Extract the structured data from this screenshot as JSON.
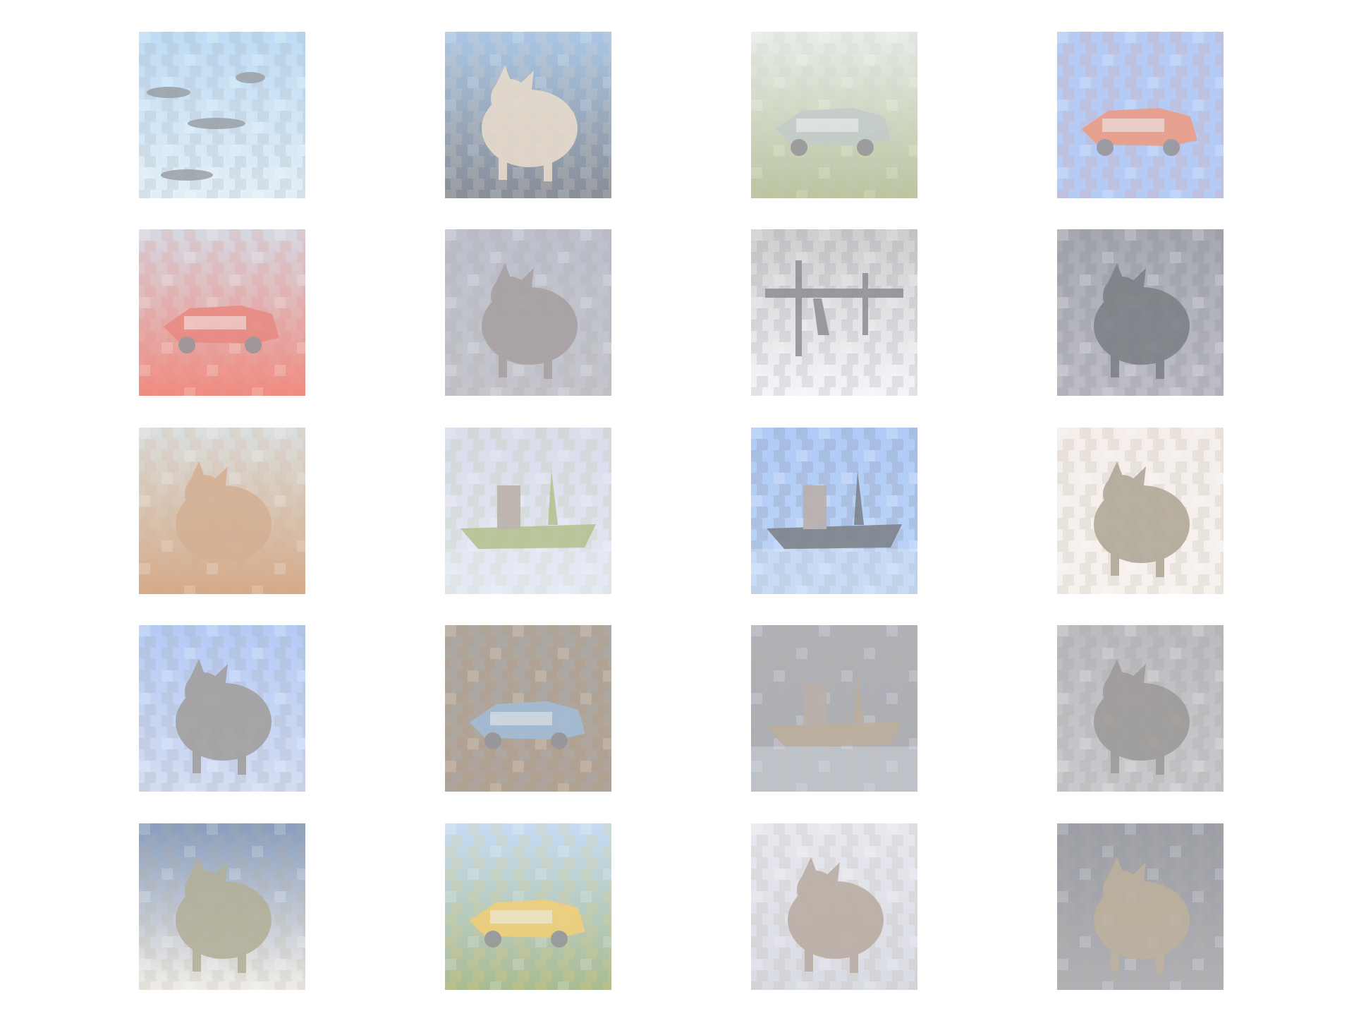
{
  "grid": {
    "rows": 5,
    "columns": 4,
    "background": "#ffffff",
    "tiles": [
      {
        "subject": "aircraft-formation-sky",
        "sky": "#8fc3ee",
        "ground": "#cfe3f1",
        "subject_color": "#56606a"
      },
      {
        "subject": "bird-over-dark-ground",
        "sky": "#6e9fd3",
        "ground": "#353d4d",
        "subject_color": "#d8c2a8"
      },
      {
        "subject": "truck-in-yard",
        "sky": "#d9e0da",
        "ground": "#8a9a57",
        "subject_color": "#9aa8a6"
      },
      {
        "subject": "orange-vehicle-blue-sky",
        "sky": "#7fa7ef",
        "ground": "#7fa7ef",
        "subject_color": "#e2542a"
      },
      {
        "subject": "red-vehicle-haze",
        "sky": "#b8bfd0",
        "ground": "#e63b27",
        "subject_color": "#d8372a"
      },
      {
        "subject": "animal-closeup",
        "sky": "#8f93a8",
        "ground": "#9b9ea9",
        "subject_color": "#6a5d61"
      },
      {
        "subject": "structure-pale-sky",
        "sky": "#aaaaae",
        "ground": "#eeeff4",
        "subject_color": "#42414b"
      },
      {
        "subject": "cat-closeup",
        "sky": "#676a77",
        "ground": "#8f8f9e",
        "subject_color": "#20262f"
      },
      {
        "subject": "deer-in-field",
        "sky": "#c1c9c8",
        "ground": "#b86d32",
        "subject_color": "#b67848"
      },
      {
        "subject": "airship-pale-sky",
        "sky": "#bec5df",
        "ground": "#d3d8ea",
        "subject_color": "#7f963f"
      },
      {
        "subject": "ship-on-water",
        "sky": "#77a6f2",
        "ground": "#8eb6f0",
        "subject_color": "#222832"
      },
      {
        "subject": "animal-on-white",
        "sky": "#eee3dc",
        "ground": "#f1e9e3",
        "subject_color": "#76684c"
      },
      {
        "subject": "animal-blue-background",
        "sky": "#7ea6ef",
        "ground": "#b6c5ea",
        "subject_color": "#5f5a57"
      },
      {
        "subject": "car-brown-background",
        "sky": "#77634f",
        "ground": "#7a5e42",
        "subject_color": "#5f8ebd"
      },
      {
        "subject": "ship-gray-water",
        "sky": "#777a85",
        "ground": "#6f737d",
        "subject_color": "#8d7555"
      },
      {
        "subject": "animal-gray-background",
        "sky": "#8b8a91",
        "ground": "#a4a2a8",
        "subject_color": "#57534f"
      },
      {
        "subject": "bird-blue-sky",
        "sky": "#35578f",
        "ground": "#e6e1d8",
        "subject_color": "#7d7750"
      },
      {
        "subject": "truck-on-grass",
        "sky": "#9cc4ee",
        "ground": "#6e8b41",
        "subject_color": "#e7ad19"
      },
      {
        "subject": "animal-pale-background",
        "sky": "#d8d9e4",
        "ground": "#bfc2cf",
        "subject_color": "#887260"
      },
      {
        "subject": "cat-dark-background",
        "sky": "#555866",
        "ground": "#777881",
        "subject_color": "#8f7a58"
      }
    ]
  }
}
